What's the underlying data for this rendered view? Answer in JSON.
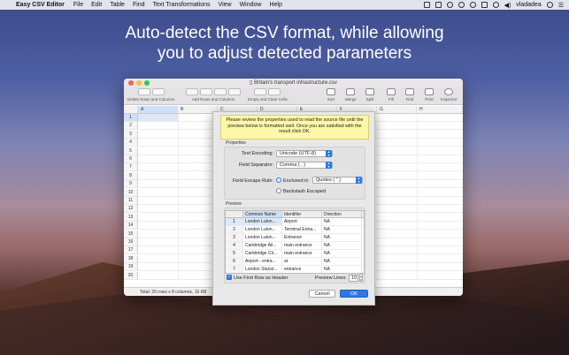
{
  "menubar": {
    "app_name": "Easy CSV Editor",
    "items": [
      "File",
      "Edit",
      "Table",
      "Find",
      "Text Transformations",
      "View",
      "Window",
      "Help"
    ],
    "user": "vladadea"
  },
  "headline": {
    "line1": "Auto-detect the CSV format, while allowing",
    "line2": "you to adjust detected parameters"
  },
  "window": {
    "title": "Britain's transport infrastructure.csv",
    "toolbar": {
      "delete_label": "Delete Rows and Columns",
      "add_label": "Add Rows and Columns",
      "empty_label": "Empty and Clear Cells",
      "sort_label": "Sort",
      "merge_label": "Merge",
      "split_label": "Split",
      "fill_label": "Fill",
      "find_label": "Find",
      "print_label": "Print",
      "inspector_label": "Inspector"
    },
    "columns": [
      "A",
      "B",
      "C",
      "D",
      "E",
      "F",
      "G",
      "H"
    ],
    "rows": [
      "1",
      "2",
      "3",
      "4",
      "5",
      "6",
      "7",
      "8",
      "9",
      "10",
      "11",
      "12",
      "13",
      "14",
      "15",
      "16",
      "17",
      "18",
      "19",
      "20"
    ],
    "status": "Total: 20 rows x 8 columns, 16 KB"
  },
  "dialog": {
    "note": "Please review the properties used to read the source file until the preview below is formatted well. Once you are satisfied with the result click OK.",
    "properties_title": "Properties",
    "text_encoding_label": "Text Encoding:",
    "text_encoding_value": "Unicode (UTF-8)",
    "field_separator_label": "Field Separator:",
    "field_separator_value": "Comma ( , )",
    "escape_rule_label": "Field Escape Rule:",
    "enclosed_label": "Enclosed in",
    "enclosed_value": "Quotes ( \" )",
    "backslash_label": "Backslash Escaped",
    "preview_title": "Preview",
    "preview_headers": [
      "Common Name",
      "Identifier",
      "Direction",
      ""
    ],
    "preview_rows": [
      [
        "1",
        "London Luton...",
        "Airport",
        "NA",
        "L"
      ],
      [
        "2",
        "London Luton...",
        "Terminal Entra...",
        "NA",
        "L"
      ],
      [
        "3",
        "London Luton...",
        "Entrance",
        "NA",
        "L"
      ],
      [
        "4",
        "Cambridge Air...",
        "main entrance",
        "NA",
        "C"
      ],
      [
        "5",
        "Cambridge Cit...",
        "main entrance",
        "NA",
        "C"
      ],
      [
        "6",
        "Airport - entra...",
        "at",
        "NA",
        "N"
      ],
      [
        "7",
        "London Stanst...",
        "entrance",
        "NA",
        "N"
      ]
    ],
    "first_row_header_label": "Use First Row as Header",
    "preview_lines_label": "Preview Lines:",
    "preview_lines_value": "10",
    "cancel_label": "Cancel",
    "ok_label": "OK"
  }
}
